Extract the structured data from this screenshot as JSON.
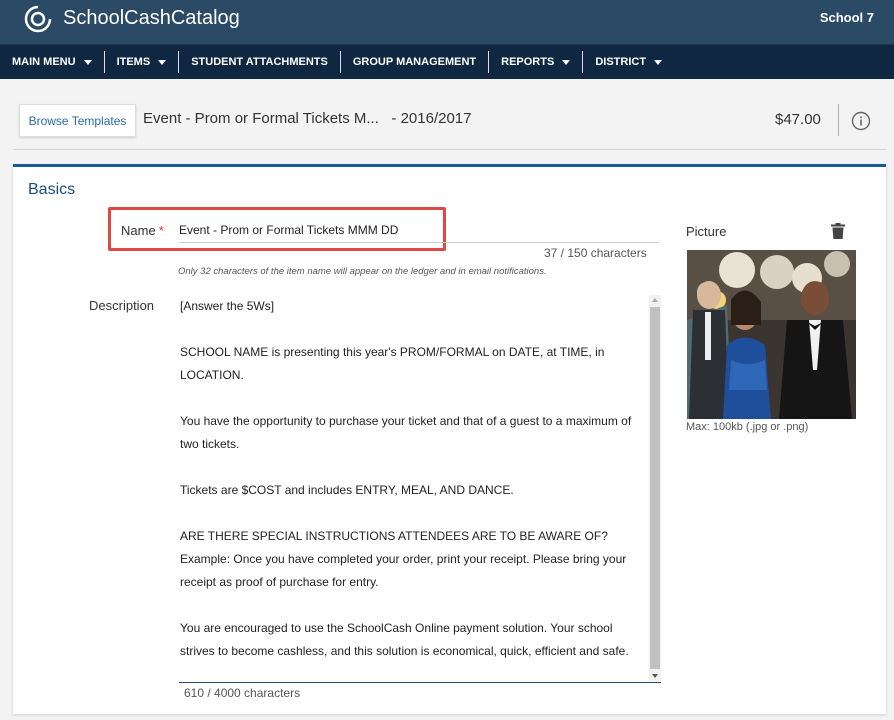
{
  "app": {
    "brand": "SchoolCashCatalog",
    "school": "School 7"
  },
  "nav": {
    "items": [
      {
        "label": "MAIN MENU",
        "dropdown": true
      },
      {
        "label": "ITEMS",
        "dropdown": true
      },
      {
        "label": "STUDENT ATTACHMENTS",
        "dropdown": false
      },
      {
        "label": "GROUP MANAGEMENT",
        "dropdown": false
      },
      {
        "label": "REPORTS",
        "dropdown": true
      },
      {
        "label": "DISTRICT",
        "dropdown": true
      }
    ]
  },
  "header": {
    "browse_label": "Browse Templates",
    "item_title": "Event - Prom or Formal Tickets M...",
    "year": "- 2016/2017",
    "price": "$47.00"
  },
  "basics": {
    "section_title": "Basics",
    "name_label": "Name",
    "required_mark": "*",
    "name_value": "Event - Prom or Formal Tickets MMM DD",
    "name_count": "37  /  150  characters",
    "name_hint": "Only 32 characters of the item name will appear on the ledger and in email notifications.",
    "description_label": "Description",
    "description_paragraphs": [
      "[Answer the 5Ws]",
      "SCHOOL NAME is presenting this year's PROM/FORMAL  on DATE, at TIME, in LOCATION.",
      "You have the opportunity to purchase your ticket and that of a guest to a maximum of two tickets.",
      "Tickets are $COST and includes ENTRY, MEAL, AND DANCE.",
      "ARE THERE SPECIAL INSTRUCTIONS ATTENDEES ARE TO BE AWARE OF? Example: Once you have completed your order, print your receipt. Please bring your receipt as proof of purchase for entry.",
      "You are encouraged to use the SchoolCash Online payment solution. Your school strives to become cashless, and this solution is economical, quick, efficient and safe."
    ],
    "description_count": "610  /  4000  characters",
    "picture_label": "Picture",
    "picture_hint": "Max: 100kb (.jpg or .png)"
  },
  "colors": {
    "topbar": "#2b4a66",
    "navbar": "#0f2740",
    "accent": "#1a5a96",
    "highlight": "#e04848"
  }
}
